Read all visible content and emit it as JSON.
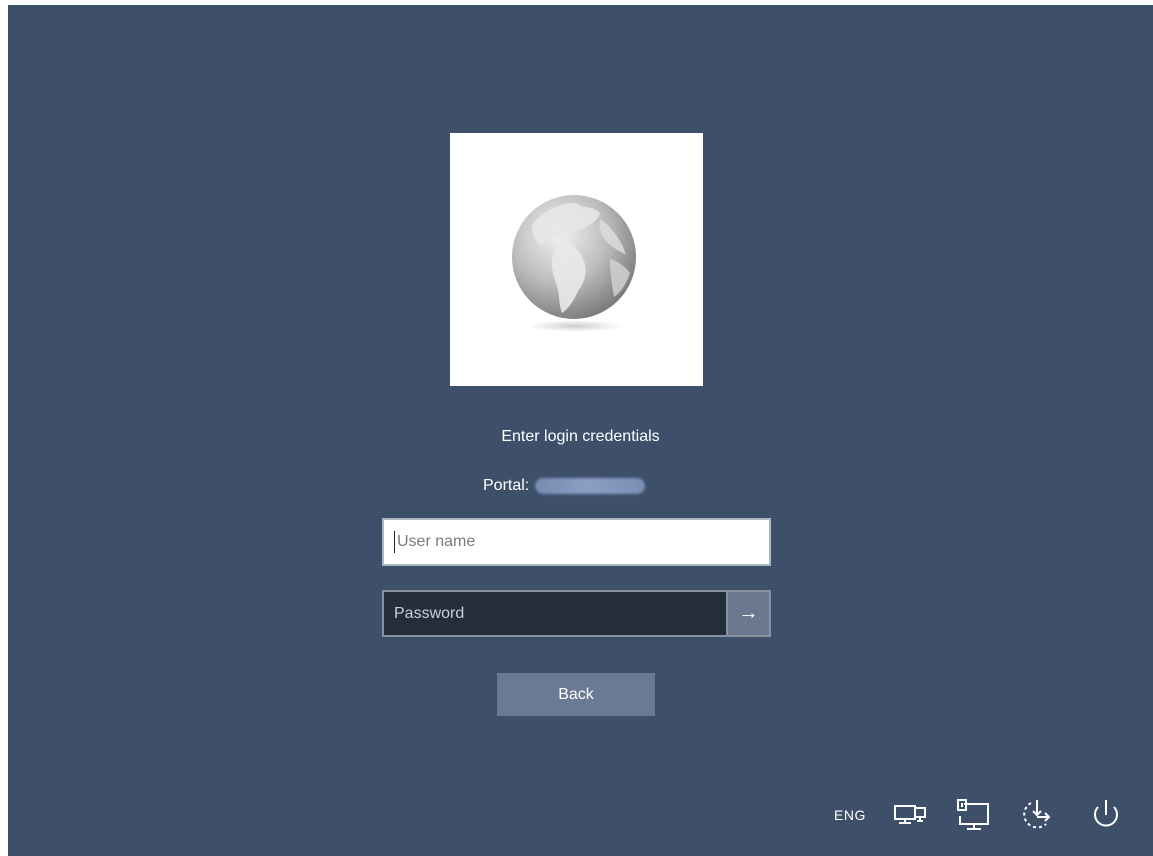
{
  "login": {
    "prompt": "Enter login credentials",
    "portal_label": "Portal:",
    "portal_value_obscured": true,
    "username_placeholder": "User name",
    "password_placeholder": "Password",
    "submit_glyph": "→",
    "back_label": "Back"
  },
  "tray": {
    "language": "ENG",
    "icons": [
      "network-icon",
      "remote-desktop-icon",
      "ease-of-access-icon",
      "power-icon"
    ]
  },
  "colors": {
    "background": "#3d4f69",
    "password_field": "#242d3b",
    "button": "#6b7a93"
  }
}
